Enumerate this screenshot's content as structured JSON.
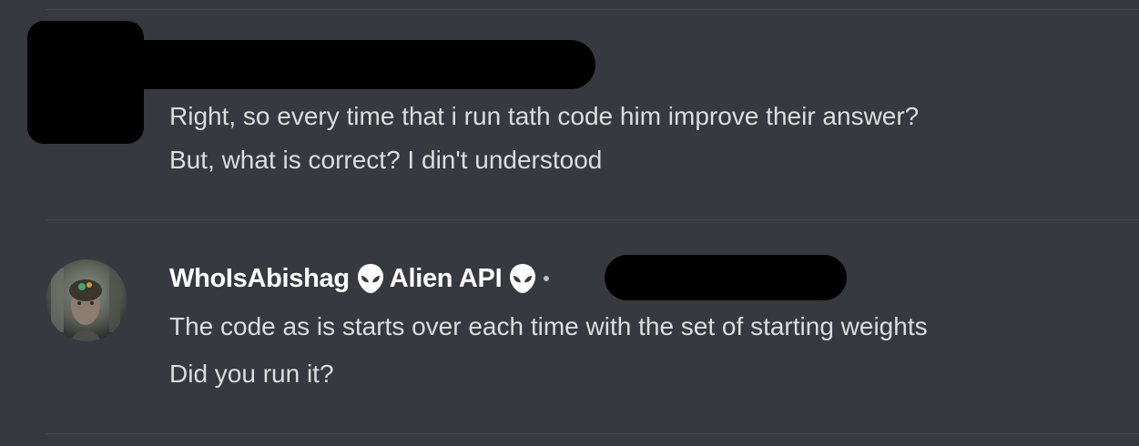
{
  "colors": {
    "background": "#36393f",
    "divider": "#42454a",
    "message_text": "#dcddde",
    "username": "#ffffff",
    "redaction": "#000000"
  },
  "message1": {
    "lines": [
      "Right, so every time that i run tath code him improve their answer?",
      "But, what is correct? I din't understood"
    ]
  },
  "message2": {
    "author": "WhoIsAbishag",
    "badge_icon": "alien-icon",
    "role_tag": "Alien API",
    "role_icon": "alien-icon",
    "lines": [
      "The code as is starts over each time with the set of starting weights",
      "Did you run it?"
    ]
  }
}
